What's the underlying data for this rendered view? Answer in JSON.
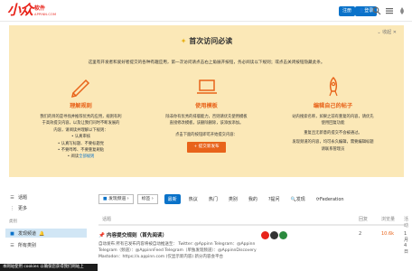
{
  "header": {
    "logo_mark": "小众",
    "logo_cn": "软件",
    "logo_url": "APPINN.COM",
    "register": "注册",
    "login": "登录"
  },
  "banner": {
    "close": "收起",
    "title": "首次访问必读",
    "intro": "这里有开发者和爱好者提交的各种有趣应用，第一次访问请点击右上角展开按钮，务必阅读以下规则；或点击关闭按钮隐藏此条。",
    "col1": {
      "title": "理解规则",
      "l1": "我们的目的是寻找并推荐优秀的应用，规则有利",
      "l2": "于高效提交内容，以及让我们同时不断发展的",
      "l3": "内容，请阅读并理解以下规则：",
      "b1": "• 认真审核",
      "b2": "• 认真写标题、不要标题党",
      "b3": "• 不要哗哗、不要重复刷贴",
      "b4_prefix": "• 阅读",
      "b4_link": "全部规则"
    },
    "col2": {
      "title": "使用模板",
      "l1": "除非你有优秀的排版能力，否则请优先使用模板",
      "l2": "直接修改模板，该删除删除，该添加添加。",
      "l3": "点击下面的按钮即可开始提交内容：",
      "button": "提交新发布"
    },
    "col3": {
      "title": "编辑自己的帖子",
      "l1": "站内搜索名称，如果之前有重复的内容，请优先",
      "l2": "使用回复功能",
      "l3": "重复且无新意的提交不会被通过。",
      "l4": "发现频道的内容，均可永久编辑，需要编辑标题",
      "l5": "请联系管理员"
    }
  },
  "sidebar": {
    "topics": "话题",
    "more": "更多",
    "section": "类别",
    "discover": "发现频道",
    "all_categories": "所有类别"
  },
  "toolbar": {
    "category": "发现频道",
    "tags": "标签",
    "tabs": [
      "最新",
      "热议",
      "热门",
      "类别",
      "我的",
      "?提问",
      "发现",
      "Federation"
    ]
  },
  "list": {
    "col_topic": "话题",
    "col_replies": "回复",
    "col_views": "浏览量",
    "col_activity": "活动",
    "row": {
      "title": "内容提交规则（首先阅读）",
      "excerpt": "自动发布 所有已发布内容将被自动推送至： Twitter: @Appinn Telegram：@Appinn Telegram（频道）：@AppinnFeed Telegram（单独发现频道）：@AppinnDiscovery Mastodon：https://x.appinn.com (仅显示新内容) 新分内容会平台",
      "replies": "2",
      "views": "10.6k",
      "activity": "1月 4日"
    }
  },
  "cookie": "本网站使用 cookies 以确保您获得我们网站上",
  "colors": {
    "accent": "#0a72c9",
    "brand": "#e8231a",
    "banner": "#fbe8b7",
    "orange": "#e8631a"
  }
}
